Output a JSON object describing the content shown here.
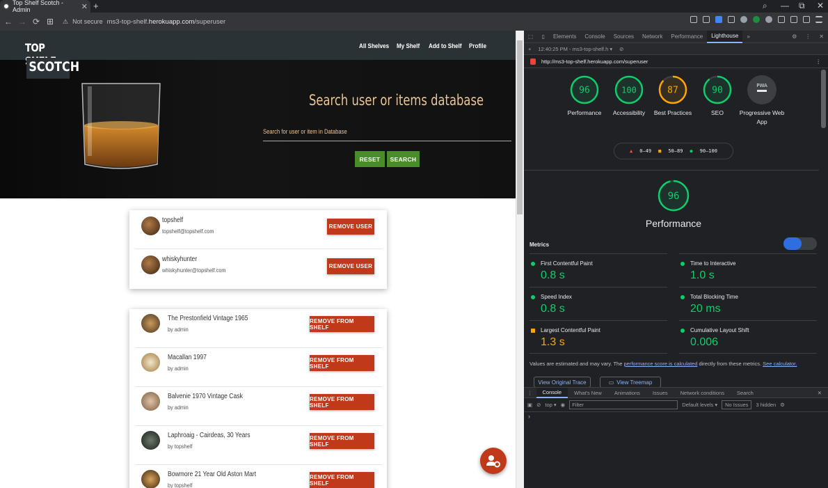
{
  "browser": {
    "tab_title": "Top Shelf Scotch - Admin",
    "tab_close": "✕",
    "new_tab": "+",
    "security": "Not secure",
    "url_prefix": "ms3-top-shelf.",
    "url_host": "herokuapp.com",
    "url_suffix": "/superuser",
    "nav_back": "←",
    "nav_forward": "→",
    "nav_reload": "⟳",
    "apps_icon": "⊞",
    "window_search": "⌕",
    "window_min": "—",
    "window_restore": "⧉",
    "window_close": "✕",
    "extensions": [
      "share-icon",
      "camera-icon",
      "shield-icon",
      "play-icon",
      "heart-icon",
      "a-icon",
      "w-icon",
      "cube-icon",
      "cast-icon",
      "download-icon",
      "menu-icon"
    ]
  },
  "site": {
    "logo_line1": "TOP SHELF",
    "logo_line2": "SCOTCH",
    "nav": [
      "All Shelves",
      "My Shelf",
      "Add to Shelf",
      "Profile"
    ],
    "hero_title": "Search user or items database",
    "search_placeholder": "Search for user or item in Database",
    "reset_label": "RESET",
    "search_label": "SEARCH",
    "users": [
      {
        "name": "topshelf",
        "email": "topshelf@topshelf.com",
        "action": "REMOVE USER"
      },
      {
        "name": "whiskyhunter",
        "email": "whiskyhunter@topshelf.com",
        "action": "REMOVE USER"
      }
    ],
    "items": [
      {
        "name": "The Prestonfield Vintage 1965",
        "by": "by admin",
        "action": "REMOVE FROM SHELF"
      },
      {
        "name": "Macallan 1997",
        "by": "by admin",
        "action": "REMOVE FROM SHELF"
      },
      {
        "name": "Balvenie 1970 Vintage Cask",
        "by": "by admin",
        "action": "REMOVE FROM SHELF"
      },
      {
        "name": "Laphroaig - Cairdeas, 30 Years",
        "by": "by topshelf",
        "action": "REMOVE FROM SHELF"
      },
      {
        "name": "Bowmore 21 Year Old Aston Mart",
        "by": "by topshelf",
        "action": "REMOVE FROM SHELF"
      }
    ],
    "accent_color": "#c0391a",
    "button_green": "#4a8c2a",
    "title_color": "#e9c596"
  },
  "devtools": {
    "tabs": [
      "Elements",
      "Console",
      "Sources",
      "Network",
      "Performance",
      "Lighthouse"
    ],
    "more": "»",
    "run_time": "12:40:25 PM - ms3-top-shelf.h ▾",
    "audit_url": "http://ms3-top-shelf.herokuapp.com/superuser",
    "scores": [
      {
        "label": "Performance",
        "value": 96,
        "color": "#0cce6b"
      },
      {
        "label": "Accessibility",
        "value": 100,
        "color": "#0cce6b"
      },
      {
        "label": "Best Practices",
        "value": 87,
        "color": "#ffa400"
      },
      {
        "label": "SEO",
        "value": 90,
        "color": "#0cce6b"
      },
      {
        "label": "Progressive Web App",
        "value": "PWA",
        "color": "#9aa0a6"
      }
    ],
    "legend": [
      "0–49",
      "50–89",
      "90–100"
    ],
    "performance_score": "96",
    "performance_label": "Performance",
    "metrics_header": "Metrics",
    "metrics": [
      {
        "name": "First Contentful Paint",
        "value": "0.8 s",
        "color": "#0cce6b"
      },
      {
        "name": "Time to Interactive",
        "value": "1.0 s",
        "color": "#0cce6b"
      },
      {
        "name": "Speed Index",
        "value": "0.8 s",
        "color": "#0cce6b"
      },
      {
        "name": "Total Blocking Time",
        "value": "20 ms",
        "color": "#0cce6b"
      },
      {
        "name": "Largest Contentful Paint",
        "value": "1.3 s",
        "color": "#ffa400"
      },
      {
        "name": "Cumulative Layout Shift",
        "value": "0.006",
        "color": "#0cce6b"
      }
    ],
    "note_pre": "Values are estimated and may vary. The ",
    "note_link": "performance score is calculated",
    "note_mid": " directly from these metrics. ",
    "note_link2": "See calculator.",
    "view_trace": "View Original Trace",
    "view_treemap": "View Treemap",
    "drawer_tabs": [
      "Console",
      "What's New",
      "Animations",
      "Issues",
      "Network conditions",
      "Search"
    ],
    "drawer_close": "✕",
    "context": "top ▾",
    "filter_placeholder": "Filter",
    "levels": "Default levels ▾",
    "issues": "No Issues",
    "hidden": "3 hidden",
    "prompt": "›"
  }
}
